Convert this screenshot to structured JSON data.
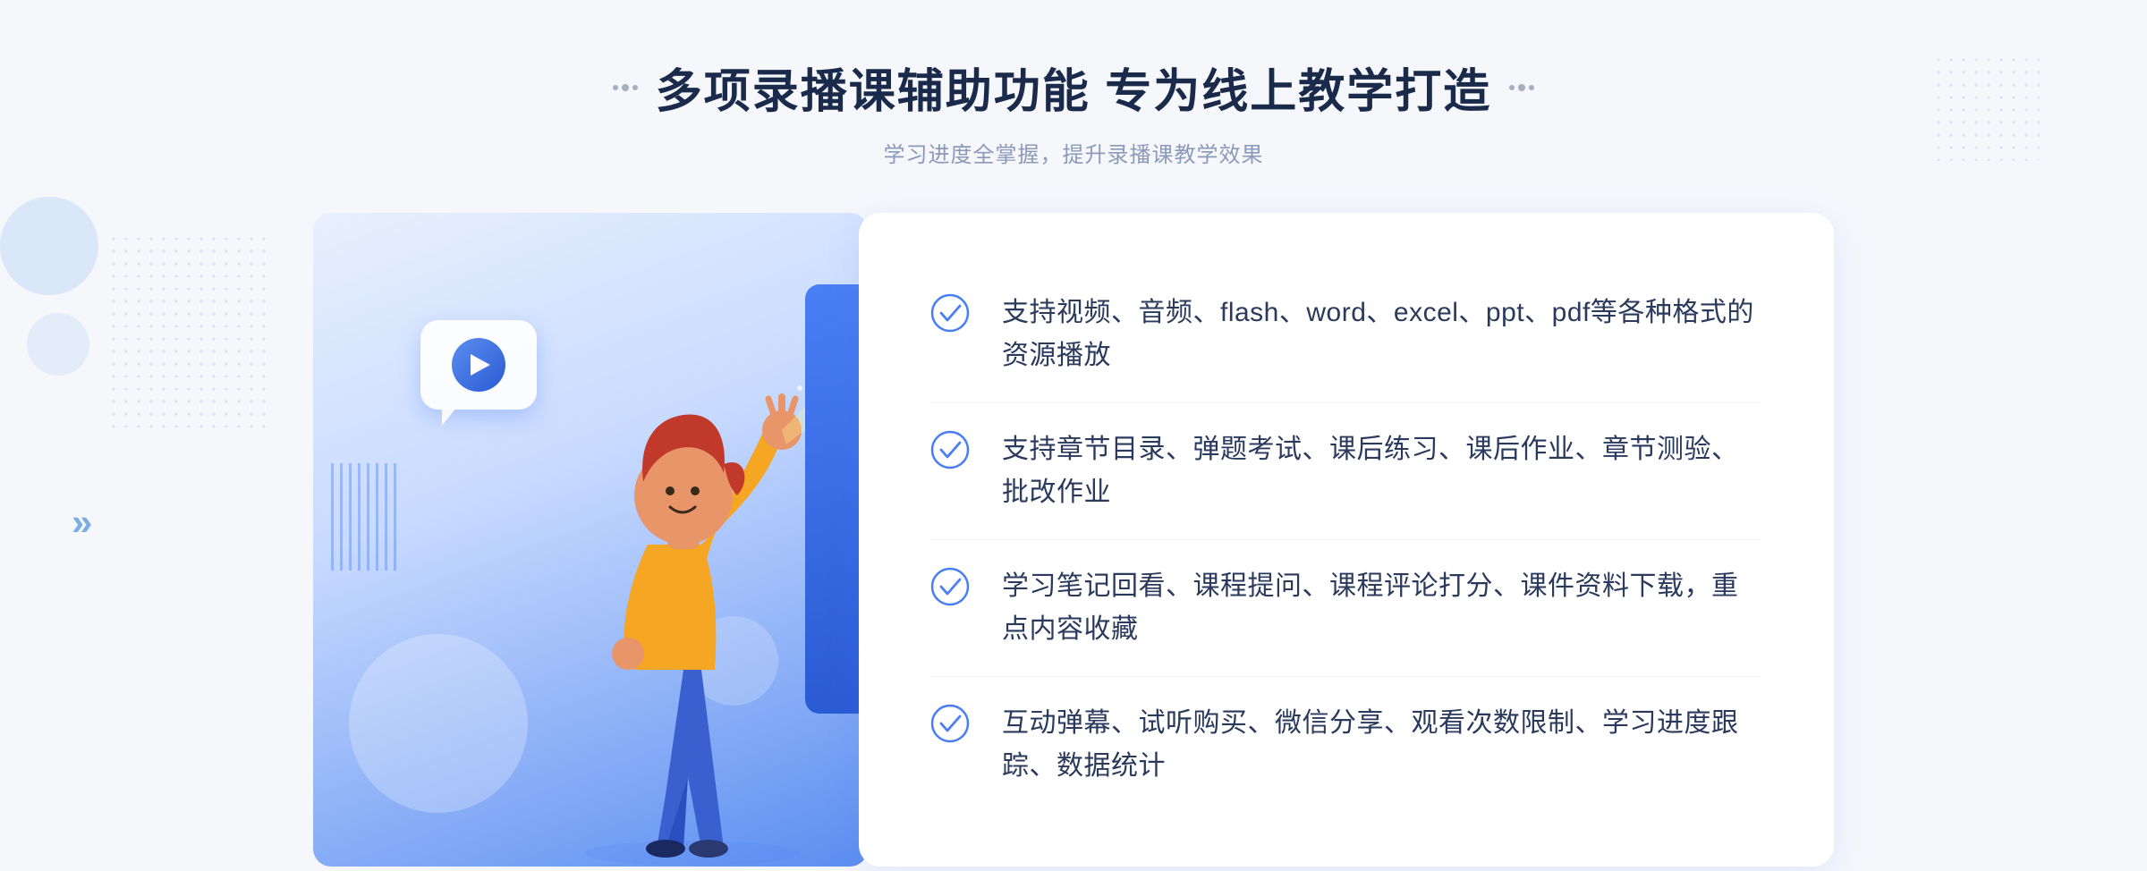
{
  "header": {
    "title": "多项录播课辅助功能 专为线上教学打造",
    "subtitle": "学习进度全掌握，提升录播课教学效果"
  },
  "features": [
    {
      "id": 1,
      "text": "支持视频、音频、flash、word、excel、ppt、pdf等各种格式的资源播放"
    },
    {
      "id": 2,
      "text": "支持章节目录、弹题考试、课后练习、课后作业、章节测验、批改作业"
    },
    {
      "id": 3,
      "text": "学习笔记回看、课程提问、课程评论打分、课件资料下载，重点内容收藏"
    },
    {
      "id": 4,
      "text": "互动弹幕、试听购买、微信分享、观看次数限制、学习进度跟踪、数据统计"
    }
  ],
  "icons": {
    "check": "check-circle-icon",
    "play": "play-icon",
    "chevron": "»"
  },
  "colors": {
    "primary": "#4a7ef5",
    "title": "#1a2a4a",
    "subtitle": "#8a9ab8",
    "feature_text": "#2a3a5c",
    "check_color": "#4a7ef5",
    "card_bg": "#ffffff"
  }
}
